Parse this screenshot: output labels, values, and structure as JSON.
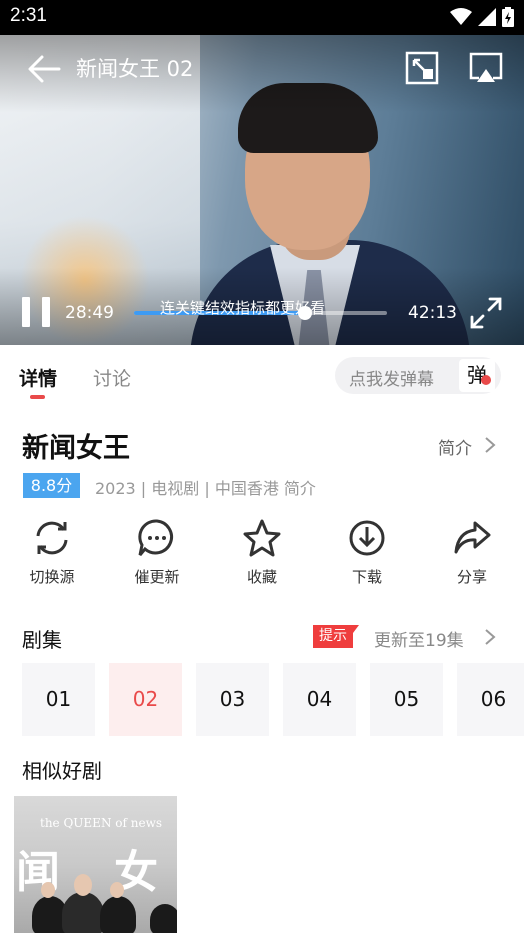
{
  "status_bar": {
    "time": "2:31",
    "icons": [
      "wifi-icon",
      "signal-icon",
      "battery-icon"
    ]
  },
  "player": {
    "title": "新闻女王 02",
    "current_time": "28:49",
    "total_time": "42:13",
    "progress": 0.677,
    "hint": "连关键结效指标都更好看",
    "controls": [
      "back-arrow-icon",
      "pip-icon",
      "cast-icon",
      "pause-icon",
      "fullscreen-icon"
    ]
  },
  "tabs": {
    "items": [
      {
        "label": "详情",
        "active": true
      },
      {
        "label": "讨论",
        "active": false
      }
    ],
    "danmaku_placeholder": "点我发弹幕",
    "danmaku_button": "弹"
  },
  "show": {
    "title": "新闻女王",
    "intro_link": "简介",
    "rating": "8.8分",
    "meta": "2023 | 电视剧 | 中国香港 简介"
  },
  "actions": [
    {
      "label": "切换源",
      "icon": "switch-source-icon"
    },
    {
      "label": "催更新",
      "icon": "chat-bubble-icon"
    },
    {
      "label": "收藏",
      "icon": "star-icon"
    },
    {
      "label": "下载",
      "icon": "download-icon"
    },
    {
      "label": "分享",
      "icon": "share-icon"
    }
  ],
  "episodes": {
    "title": "剧集",
    "notice": "提示",
    "update_text": "更新至19集",
    "items": [
      "01",
      "02",
      "03",
      "04",
      "05",
      "06"
    ],
    "active": "02"
  },
  "similar": {
    "title": "相似好剧",
    "poster_text": "the QUEEN of news",
    "poster_chars": [
      "闻",
      "女"
    ]
  },
  "colors": {
    "accent": "#e94a4a",
    "rating": "#4ba5ef",
    "progress": "#3e9bf3"
  }
}
